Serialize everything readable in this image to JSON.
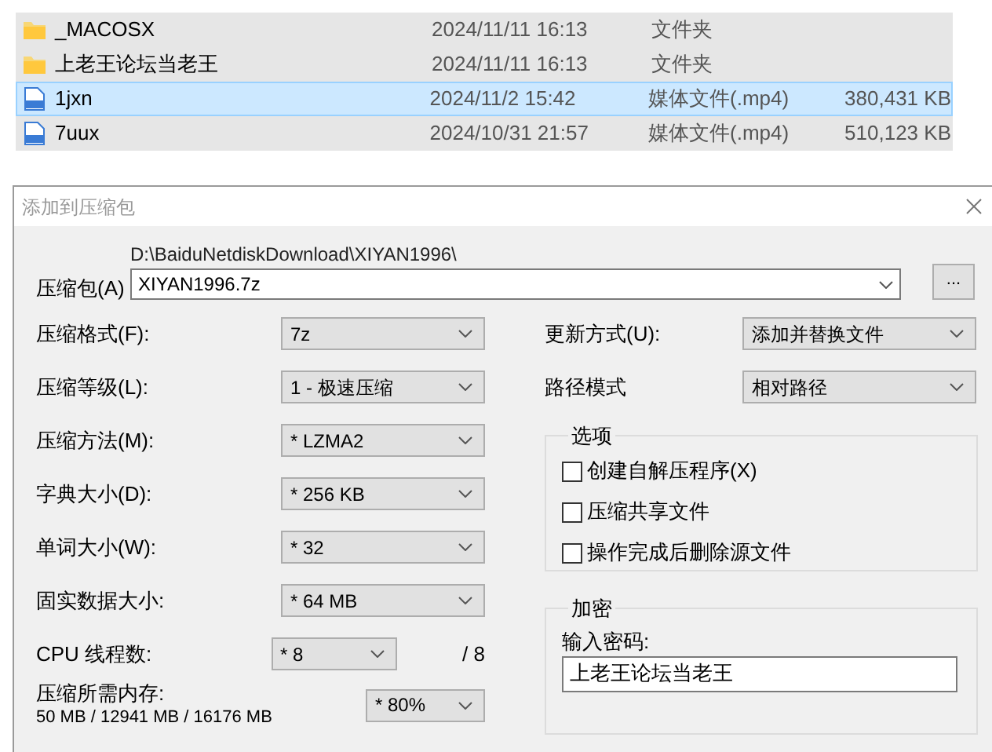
{
  "file_list": [
    {
      "kind": "folder",
      "name": "_MACOSX",
      "modified": "2024/11/11 16:13",
      "type": "文件夹",
      "selected": false
    },
    {
      "kind": "folder",
      "name": "上老王论坛当老王",
      "modified": "2024/11/11 16:13",
      "type": "文件夹",
      "selected": false
    },
    {
      "kind": "video",
      "name": "1jxn",
      "modified": "2024/11/2 15:42",
      "type": "媒体文件(.mp4)",
      "size": "380,431 KB",
      "selected": true
    },
    {
      "kind": "video",
      "name": "7uux",
      "modified": "2024/10/31 21:57",
      "type": "媒体文件(.mp4)",
      "size": "510,123 KB",
      "selected": false
    }
  ],
  "dialog": {
    "title": "添加到压缩包",
    "archive": {
      "label": "压缩包(A)",
      "path": "D:\\BaiduNetdiskDownload\\XIYAN1996\\",
      "value": "XIYAN1996.7z",
      "browse_button": "..."
    },
    "left_fields": [
      {
        "label": "压缩格式(F):",
        "value": "7z"
      },
      {
        "label": "压缩等级(L):",
        "value": "1 - 极速压缩"
      },
      {
        "label": "压缩方法(M):",
        "value": "* LZMA2"
      },
      {
        "label": "字典大小(D):",
        "value": "* 256 KB"
      },
      {
        "label": "单词大小(W):",
        "value": "* 32"
      },
      {
        "label": "固实数据大小:",
        "value": "* 64 MB"
      },
      {
        "label": "CPU 线程数:",
        "value": "* 8",
        "suffix": "/ 8"
      }
    ],
    "memory": {
      "label": "压缩所需内存:",
      "detail": "50 MB / 12941 MB / 16176 MB",
      "value": "* 80%"
    },
    "right_fields": [
      {
        "label": "更新方式(U):",
        "value": "添加并替换文件"
      },
      {
        "label": "路径模式",
        "value": "相对路径"
      }
    ],
    "options": {
      "title": "选项",
      "items": [
        {
          "label": "创建自解压程序(X)",
          "checked": false
        },
        {
          "label": "压缩共享文件",
          "checked": false
        },
        {
          "label": "操作完成后删除源文件",
          "checked": false
        }
      ]
    },
    "encryption": {
      "title": "加密",
      "label": "输入密码:",
      "value": "上老王论坛当老王"
    }
  }
}
